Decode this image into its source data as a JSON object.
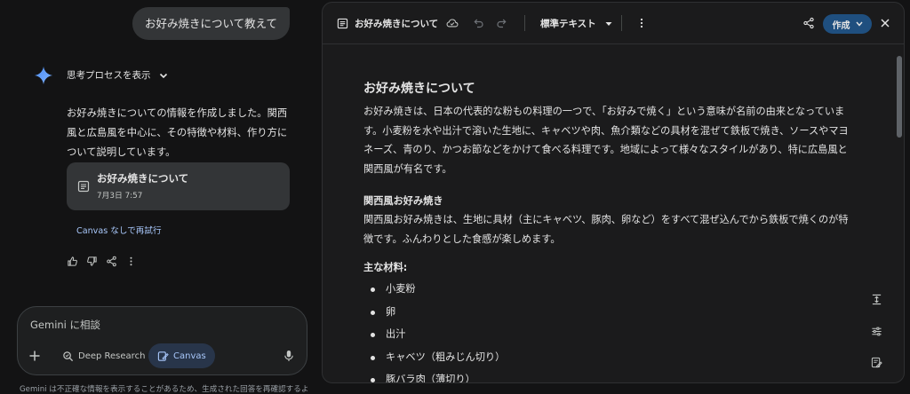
{
  "chat": {
    "user_message": "お好み焼きについて教えて",
    "thinking_label": "思考プロセスを表示",
    "response_text": "お好み焼きについての情報を作成しました。関西風と広島風を中心に、その特徴や材料、作り方について説明しています。",
    "doc_card": {
      "title": "お好み焼きについて",
      "date": "7月3日 7:57"
    },
    "retry_label": "Canvas なしで再試行",
    "action_icons": [
      "thumb-up-icon",
      "thumb-down-icon",
      "share-icon",
      "more-vert-icon"
    ],
    "composer": {
      "placeholder": "Gemini に相談",
      "deep_research_label": "Deep Research",
      "canvas_label": "Canvas"
    },
    "disclaimer": "Gemini は不正確な情報を表示することがあるため、生成された回答を再確認するよ"
  },
  "canvas": {
    "toolbar": {
      "title": "お好み焼きについて",
      "style_label": "標準テキスト",
      "create_label": "作成"
    },
    "doc": {
      "heading": "お好み焼きについて",
      "intro": "お好み焼きは、日本の代表的な粉もの料理の一つで、「お好みで焼く」という意味が名前の由来となっています。小麦粉を水や出汁で溶いた生地に、キャベツや肉、魚介類などの具材を混ぜて鉄板で焼き、ソースやマヨネーズ、青のり、かつお節などをかけて食べる料理です。地域によって様々なスタイルがあり、特に広島風と関西風が有名です。",
      "section_title": "関西風お好み焼き",
      "section_text": "関西風お好み焼きは、生地に具材（主にキャベツ、豚肉、卵など）をすべて混ぜ込んでから鉄板で焼くのが特徴です。ふんわりとした食感が楽しめます。",
      "materials_title": "主な材料:",
      "materials": [
        "小麦粉",
        "卵",
        "出汁",
        "キャベツ（粗みじん切り）",
        "豚バラ肉（薄切り）"
      ]
    }
  },
  "colors": {
    "background": "#131314",
    "surface": "#1b1b1c",
    "bubble": "#333537",
    "accent_link": "#a8c7fa",
    "create_button": "#1f4f7f"
  }
}
